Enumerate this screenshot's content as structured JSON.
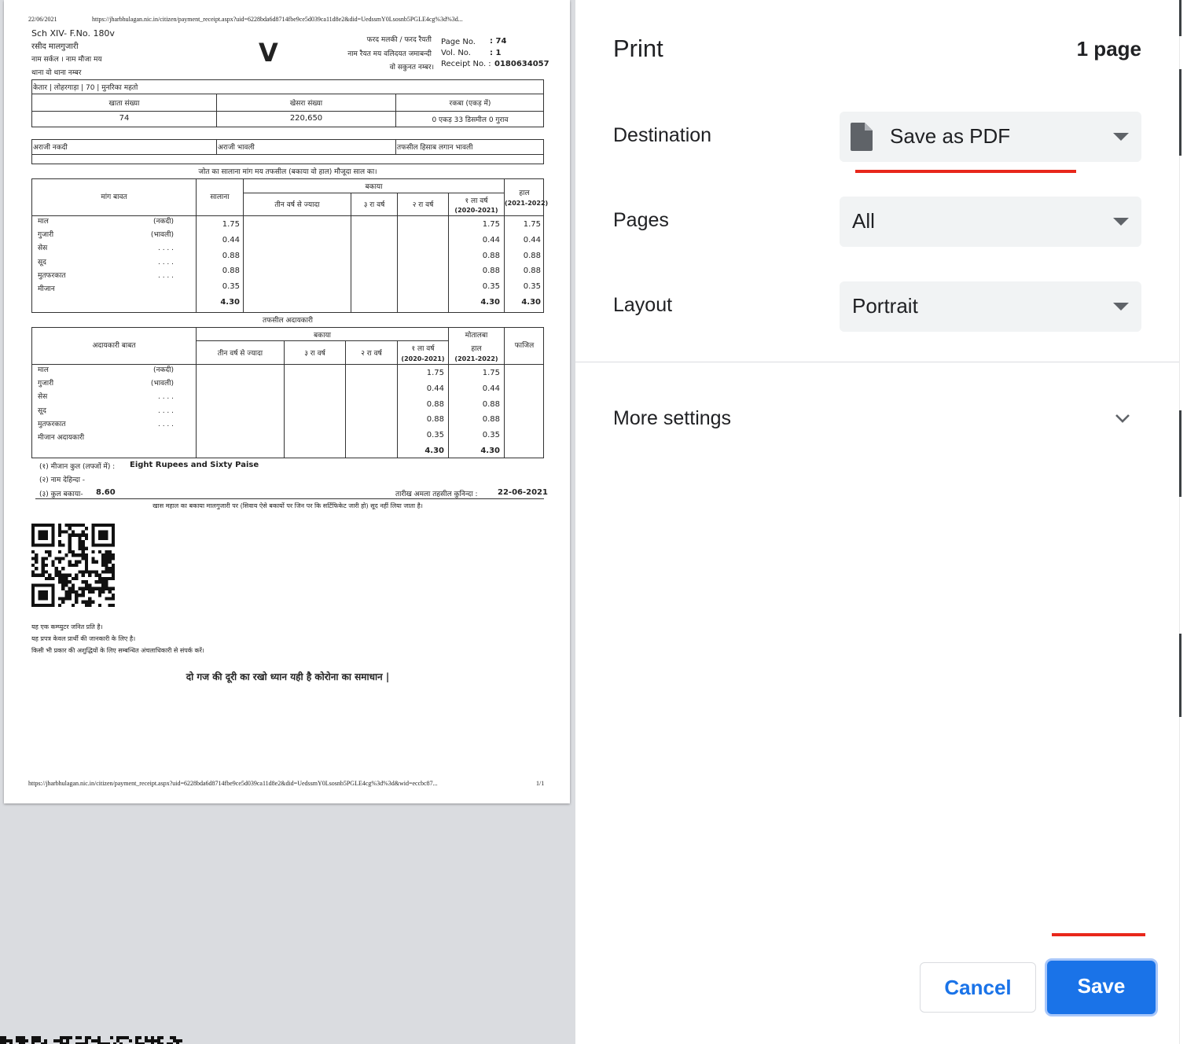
{
  "settings": {
    "title": "Print",
    "page_count": "1 page",
    "destination": {
      "label": "Destination",
      "value": "Save as PDF",
      "icon": "file-icon"
    },
    "pages": {
      "label": "Pages",
      "value": "All"
    },
    "layout": {
      "label": "Layout",
      "value": "Portrait"
    },
    "more_settings": "More settings",
    "cancel_label": "Cancel",
    "save_label": "Save",
    "accent_color": "#1a73e8",
    "annotation_color": "#e8271b"
  },
  "preview": {
    "header_date": "22/06/2021",
    "header_url": "https://jharbhulagan.nic.in/citizen/payment_receipt.aspx?uid=6228bda6d8714fbe9ce5d039ca11d8e2&did=UedssmY0Lsosnb5PGLE4cg%3d%3d...",
    "sch": "Sch XIV- F.No. 180v",
    "rasid": "रसीद मालगुजारी",
    "naam_circle": "नाम सर्कल । नाम मौजा मय",
    "thana": "थाना वो थाना नम्बर",
    "big_letter": "V",
    "fard": "फरद मलकी / फरद रैयती",
    "naam_raiyat": "नाम रैयत मय वलिदयत जमाबन्दी",
    "sakunat": "वो सकुनत नम्बर।",
    "page_no_label": "Page No.",
    "page_no_value": ": 74",
    "vol_no_label": "Vol. No.",
    "vol_no_value": ": 1",
    "receipt_no_label": "Receipt No. :",
    "receipt_no_value": "0180634057",
    "address_line": "केतार | लोहरगाड़ा | 70 | मुनरिका महतो",
    "land_headers": [
      "खाता संख्या",
      "खेसरा संख्या",
      "रकबा (एकड़ में)"
    ],
    "land_values": [
      "74",
      "220,650",
      "0 एकड़ 33 डिसमील 0 गुराव"
    ],
    "araji": [
      "अराजी नकदी",
      "अराजी भावली",
      "तफसील हिसाब लगान भावली"
    ],
    "demand_caption": "जोत का सालाना मांग मय तफसील (बकाया वो हाल) मौजूदा साल का।",
    "demand_headers": {
      "mang_bawat": "मांग बावत",
      "salana": "सालाना",
      "bakaya": "बकाया",
      "teen_varsh": "तीन वर्ष से ज्यादा",
      "teesra": "३ रा वर्ष",
      "doosra": "२ रा वर्ष",
      "pehla": "१ ला वर्ष",
      "pehla_years": "(2020-2021)",
      "haal": "हाल",
      "haal_years": "(2021-2022)"
    },
    "demand_labels": [
      "माल",
      "गुजारी",
      "सेस",
      "सूद",
      "मुतफरकात",
      "मीजान"
    ],
    "demand_sublabels": [
      "(नकदी)",
      "(भावली)",
      ". . . .",
      ". . . .",
      ". . . ."
    ],
    "demand_salana": [
      "1.75",
      "0.44",
      "0.88",
      "0.88",
      "0.35",
      "4.30"
    ],
    "demand_pehla": [
      "1.75",
      "0.44",
      "0.88",
      "0.88",
      "0.35",
      "4.30"
    ],
    "demand_haal": [
      "1.75",
      "0.44",
      "0.88",
      "0.88",
      "0.35",
      "4.30"
    ],
    "payment_caption": "तफसील अदायकारी",
    "payment_headers": {
      "adayakari_bawat": "अदायकारी बाबत",
      "bakaya": "बकाया",
      "teen_varsh": "तीन वर्ष से ज्यादा",
      "teesra": "३ रा वर्ष",
      "doosra": "२ रा वर्ष",
      "pehla": "१ ला वर्ष",
      "pehla_years": "(2020-2021)",
      "motalaba": "मोतालबा",
      "haal": "हाल",
      "haal_years": "(2021-2022)",
      "fazil": "फाजिल"
    },
    "payment_labels": [
      "माल",
      "गुजारी",
      "सेस",
      "सूद",
      "मुतफरकात",
      "मीजान अदायकारी"
    ],
    "payment_sublabels": [
      "(नकदी)",
      "(भावली)",
      ". . . .",
      ". . . .",
      ". . . ."
    ],
    "payment_pehla": [
      "1.75",
      "0.44",
      "0.88",
      "0.88",
      "0.35",
      "4.30"
    ],
    "payment_haal": [
      "1.75",
      "0.44",
      "0.88",
      "0.88",
      "0.35",
      "4.30"
    ],
    "mizan_label": "(१) मीजान कुल (लफ्जों में) :",
    "mizan_value": "Eight Rupees and Sixty Paise",
    "naam_dehinda": "(२) नाम देहिन्दा -",
    "kul_bakaya_label": "(३) कुल बकाया-",
    "kul_bakaya_value": "8.60",
    "tarikh_label": "तारीख अमला तहसील कुनिन्दा :",
    "tarikh_value": "22-06-2021",
    "khas_mahal_note": "खास महाल का बकाया मालगुजारी पर (सिवाय ऐसे बकायों पर जिन पर कि सर्टिफिकेट जारी हो) सूद नहीं लिया जाता है।",
    "notes": [
      "यह एक कम्प्युटर जनित प्रति है।",
      "यह प्रपत्र केवल प्रार्थी की जानकारी के लिए है।",
      "किसी भी प्रकार की अशुद्धियों के लिए सम्बन्धित अंचलाधिकारी से संपर्क करें।"
    ],
    "slogan": "दो गज की दूरी का रखो ध्यान यही है कोरोना का समाधान |",
    "footer_url": "https://jharbhulagan.nic.in/citizen/payment_receipt.aspx?uid=6228bda6d8714fbe9ce5d039ca11d8e2&did=UedssmY0Lsosnb5PGLE4cg%3d%3d&wid=eccbc87...",
    "footer_page": "1/1"
  }
}
